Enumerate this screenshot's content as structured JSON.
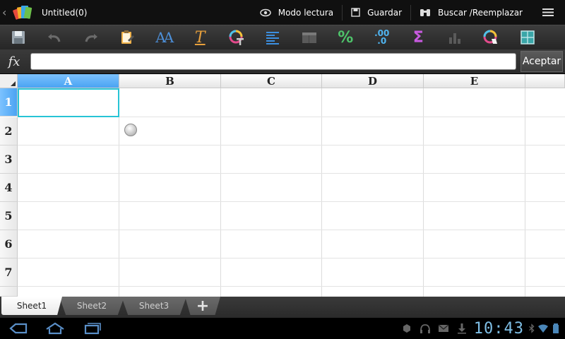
{
  "actionbar": {
    "title": "Untitled(0)",
    "actions": [
      {
        "label": "Modo lectura",
        "icon": "eye-icon"
      },
      {
        "label": "Guardar",
        "icon": "save-icon"
      },
      {
        "label": "Buscar /Reemplazar",
        "icon": "binoculars-icon"
      }
    ]
  },
  "toolbar": {
    "icons": [
      "save-icon",
      "undo-icon",
      "redo-icon",
      "clipboard-icon",
      "font-size-icon",
      "font-style-icon",
      "font-color-icon",
      "align-icon",
      "merge-icon",
      "percent-icon",
      "decimal-icon",
      "sum-icon",
      "chart-icon",
      "fill-color-icon",
      "borders-icon"
    ],
    "font_size_label": "AA",
    "font_style_label": "T",
    "percent_label": "%",
    "decimal_label": ".00",
    "decimal_label2": ".0",
    "sum_label": "Σ"
  },
  "formula": {
    "fx_label": "fx",
    "value": "",
    "accept_label": "Aceptar"
  },
  "grid": {
    "columns": [
      "A",
      "B",
      "C",
      "D",
      "E"
    ],
    "rows": [
      "1",
      "2",
      "3",
      "4",
      "5",
      "6",
      "7"
    ],
    "active_column": "A",
    "active_row": "1"
  },
  "sheets": {
    "tabs": [
      "Sheet1",
      "Sheet2",
      "Sheet3"
    ],
    "active": "Sheet1",
    "add_label": "+"
  },
  "system": {
    "clock": "10:43"
  },
  "colors": {
    "selection": "#27c4d6",
    "header_active": "#4aa3f2",
    "clock": "#7fbfe6"
  }
}
